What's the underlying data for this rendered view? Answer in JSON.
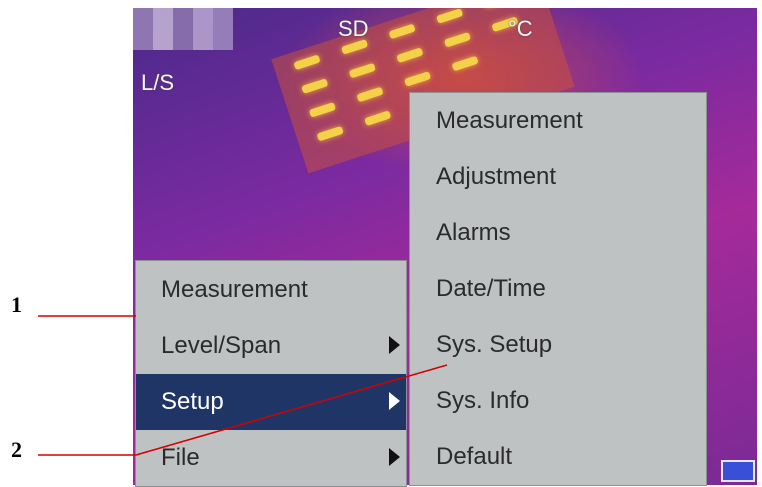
{
  "osd": {
    "top_left_mode": "L/S",
    "storage": "SD",
    "unit": "°C"
  },
  "main_menu": {
    "items": [
      {
        "label": "Measurement",
        "has_submenu": false,
        "selected": false
      },
      {
        "label": "Level/Span",
        "has_submenu": true,
        "selected": false
      },
      {
        "label": "Setup",
        "has_submenu": true,
        "selected": true
      },
      {
        "label": "File",
        "has_submenu": true,
        "selected": false
      }
    ]
  },
  "setup_submenu": {
    "items": [
      {
        "label": "Measurement"
      },
      {
        "label": "Adjustment"
      },
      {
        "label": "Alarms"
      },
      {
        "label": "Date/Time"
      },
      {
        "label": "Sys. Setup"
      },
      {
        "label": "Sys. Info"
      },
      {
        "label": "Default"
      }
    ]
  },
  "callouts": {
    "one": "1",
    "two": "2",
    "line_color": "#d40000"
  },
  "colors": {
    "menu_bg": "#bfc2c3",
    "selected_bg": "#1f3566",
    "battery": "#3a4fd8"
  }
}
